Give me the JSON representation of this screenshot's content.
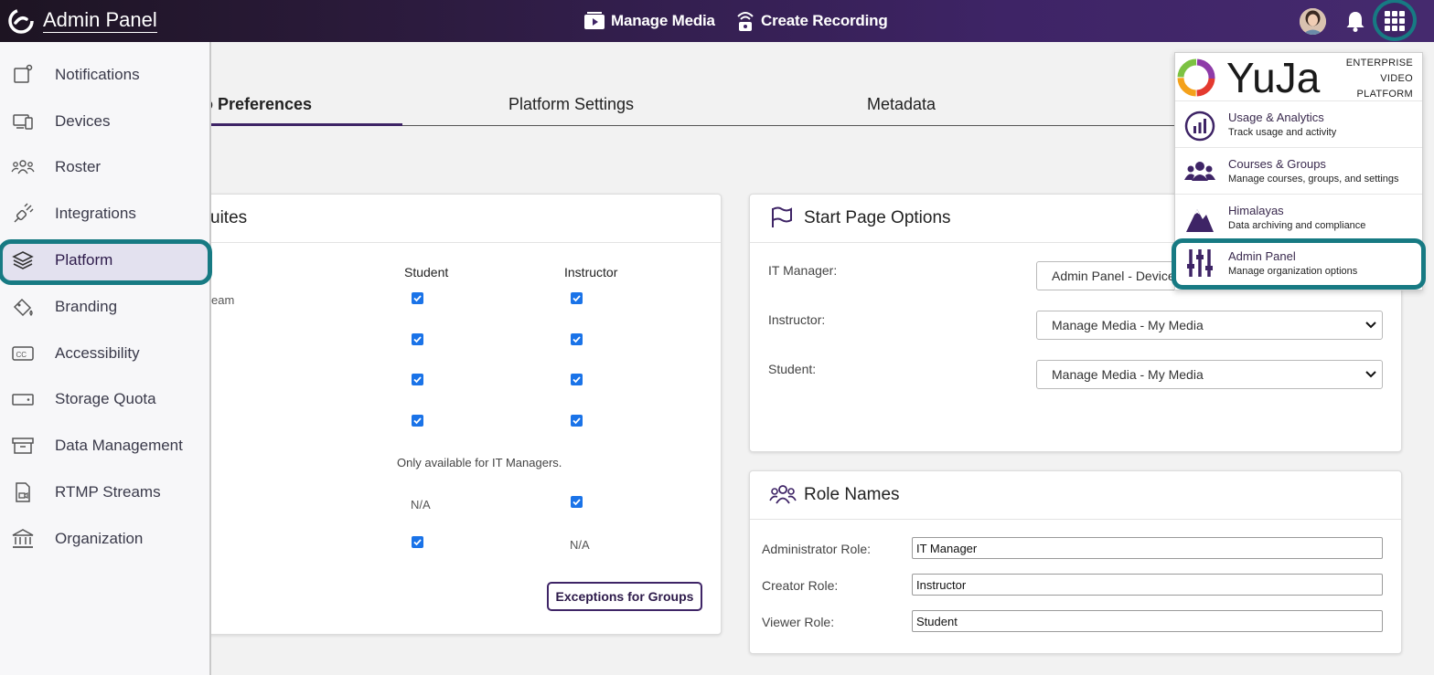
{
  "app": {
    "title": "Admin Panel"
  },
  "topbar": {
    "manage_media": "Manage Media",
    "create_recording": "Create Recording"
  },
  "sidebar": {
    "items": [
      {
        "label": "Notifications",
        "icon": "notifications-icon"
      },
      {
        "label": "Devices",
        "icon": "devices-icon"
      },
      {
        "label": "Roster",
        "icon": "roster-icon"
      },
      {
        "label": "Integrations",
        "icon": "integrations-icon"
      },
      {
        "label": "Platform",
        "icon": "layers-icon",
        "active": true
      },
      {
        "label": "Branding",
        "icon": "branding-icon"
      },
      {
        "label": "Accessibility",
        "icon": "cc-icon"
      },
      {
        "label": "Storage Quota",
        "icon": "storage-icon"
      },
      {
        "label": "Data Management",
        "icon": "archive-icon"
      },
      {
        "label": "RTMP Streams",
        "icon": "rtmp-icon"
      },
      {
        "label": "Organization",
        "icon": "bank-icon"
      }
    ]
  },
  "tabs": {
    "preferences": "Preferences",
    "platform_settings": "Platform Settings",
    "metadata": "Metadata",
    "preferences_partial": "o Preferences"
  },
  "suites_card": {
    "title_partial": "uites",
    "col_student": "Student",
    "col_instructor": "Instructor",
    "row1_partial": "eam",
    "note": "Only available for IT Managers.",
    "na": "N/A",
    "exceptions_button": "Exceptions for Groups"
  },
  "start_page": {
    "title": "Start Page Options",
    "it_manager_label": "IT Manager:",
    "it_manager_value": "Admin Panel - Devices",
    "instructor_label": "Instructor:",
    "instructor_value": "Manage Media - My Media",
    "student_label": "Student:",
    "student_value": "Manage Media - My Media"
  },
  "role_names": {
    "title": "Role Names",
    "admin_label": "Administrator Role:",
    "admin_value": "IT Manager",
    "creator_label": "Creator Role:",
    "creator_value": "Instructor",
    "viewer_label": "Viewer Role:",
    "viewer_value": "Student"
  },
  "apps_panel": {
    "logo_text": "YuJa",
    "enterprise": "ENTERPRISE",
    "video": "VIDEO",
    "platform": "PLATFORM",
    "items": [
      {
        "title": "Usage & Analytics",
        "subtitle": "Track usage and activity"
      },
      {
        "title": "Courses & Groups",
        "subtitle": "Manage courses, groups, and settings"
      },
      {
        "title": "Himalayas",
        "subtitle": "Data archiving and compliance"
      },
      {
        "title": "Admin Panel",
        "subtitle": "Manage organization options"
      }
    ]
  },
  "colors": {
    "brand_purple": "#3e2466",
    "highlight_teal": "#177a83",
    "checkbox_blue": "#1a73e8"
  }
}
